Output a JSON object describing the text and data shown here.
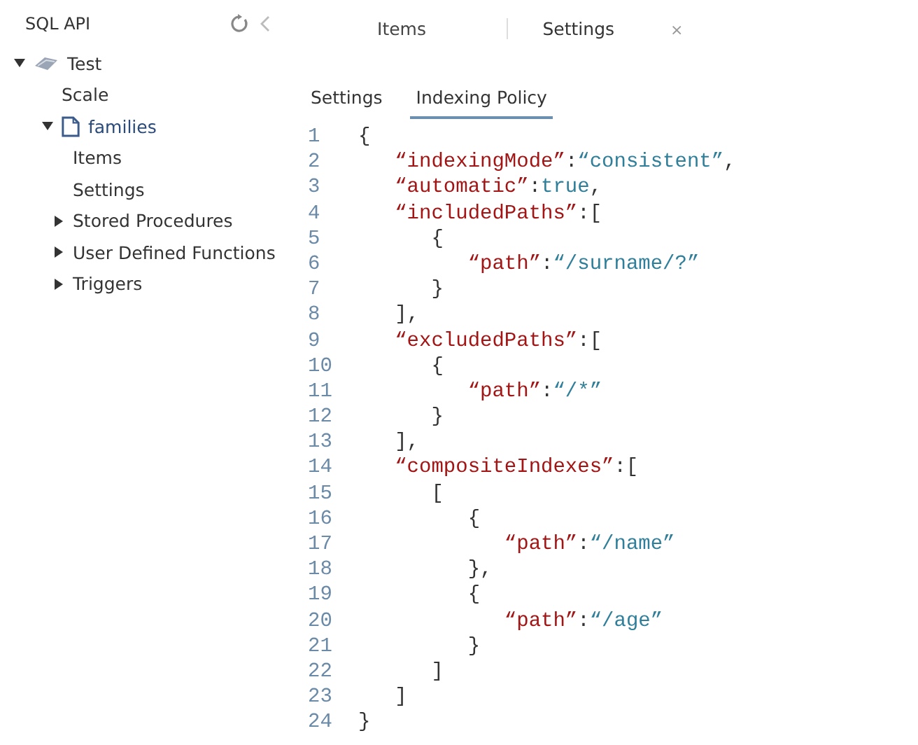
{
  "sidebar": {
    "title": "SQL API",
    "tree": [
      {
        "label": "Test",
        "kind": "database",
        "expanded": true,
        "children": [
          {
            "label": "Scale",
            "kind": "leaf"
          },
          {
            "label": "families",
            "kind": "collection",
            "expanded": true,
            "children": [
              {
                "label": "Items",
                "kind": "leaf"
              },
              {
                "label": "Settings",
                "kind": "leaf"
              },
              {
                "label": "Stored Procedures",
                "kind": "group",
                "expanded": false
              },
              {
                "label": "User Defined Functions",
                "kind": "group",
                "expanded": false
              },
              {
                "label": "Triggers",
                "kind": "group",
                "expanded": false
              }
            ]
          }
        ]
      }
    ]
  },
  "tabs": [
    {
      "label": "Items",
      "selected": false
    },
    {
      "label": "Settings",
      "selected": true,
      "close": "×"
    }
  ],
  "subtabs": [
    {
      "label": "Settings",
      "selected": false
    },
    {
      "label": "Indexing Policy",
      "selected": true
    }
  ],
  "editor": {
    "lines": [
      {
        "number": "1",
        "tokens": [
          {
            "kind": "punct",
            "text": "{"
          }
        ]
      },
      {
        "number": "2",
        "tokens": [
          {
            "kind": "key",
            "text": "   “indexingMode”"
          },
          {
            "kind": "punct",
            "text": ":"
          },
          {
            "kind": "string",
            "text": "“consistent”"
          },
          {
            "kind": "punct",
            "text": ","
          }
        ]
      },
      {
        "number": "3",
        "tokens": [
          {
            "kind": "key",
            "text": "   “automatic”"
          },
          {
            "kind": "punct",
            "text": ":"
          },
          {
            "kind": "string",
            "text": "true"
          },
          {
            "kind": "punct",
            "text": ","
          }
        ]
      },
      {
        "number": "4",
        "tokens": [
          {
            "kind": "key",
            "text": "   “includedPaths”"
          },
          {
            "kind": "punct",
            "text": ":["
          }
        ]
      },
      {
        "number": "5",
        "tokens": [
          {
            "kind": "punct",
            "text": "      {"
          }
        ]
      },
      {
        "number": "6",
        "tokens": [
          {
            "kind": "key",
            "text": "         “path”"
          },
          {
            "kind": "punct",
            "text": ":"
          },
          {
            "kind": "string",
            "text": "“/surname/?”"
          }
        ]
      },
      {
        "number": "7",
        "tokens": [
          {
            "kind": "punct",
            "text": "      }"
          }
        ]
      },
      {
        "number": "8",
        "tokens": [
          {
            "kind": "punct",
            "text": "   ],"
          }
        ]
      },
      {
        "number": "9",
        "tokens": [
          {
            "kind": "key",
            "text": "   “excludedPaths”"
          },
          {
            "kind": "punct",
            "text": ":["
          }
        ]
      },
      {
        "number": "10",
        "tokens": [
          {
            "kind": "punct",
            "text": "      {"
          }
        ]
      },
      {
        "number": "11",
        "tokens": [
          {
            "kind": "key",
            "text": "         “path”"
          },
          {
            "kind": "punct",
            "text": ":"
          },
          {
            "kind": "string",
            "text": "“/*”"
          }
        ]
      },
      {
        "number": "12",
        "tokens": [
          {
            "kind": "punct",
            "text": "      }"
          }
        ]
      },
      {
        "number": "13",
        "tokens": [
          {
            "kind": "punct",
            "text": "   ],"
          }
        ]
      },
      {
        "number": "14",
        "tokens": [
          {
            "kind": "key",
            "text": "   “compositeIndexes”"
          },
          {
            "kind": "punct",
            "text": ":["
          }
        ]
      },
      {
        "number": "15",
        "tokens": [
          {
            "kind": "punct",
            "text": "      ["
          }
        ]
      },
      {
        "number": "16",
        "tokens": [
          {
            "kind": "punct",
            "text": "         {"
          }
        ]
      },
      {
        "number": "17",
        "tokens": [
          {
            "kind": "key",
            "text": "            “path”"
          },
          {
            "kind": "punct",
            "text": ":"
          },
          {
            "kind": "string",
            "text": "“/name”"
          }
        ]
      },
      {
        "number": "18",
        "tokens": [
          {
            "kind": "punct",
            "text": "         },"
          }
        ]
      },
      {
        "number": "19",
        "tokens": [
          {
            "kind": "punct",
            "text": "         {"
          }
        ]
      },
      {
        "number": "20",
        "tokens": [
          {
            "kind": "key",
            "text": "            “path”"
          },
          {
            "kind": "punct",
            "text": ":"
          },
          {
            "kind": "string",
            "text": "“/age”"
          }
        ]
      },
      {
        "number": "21",
        "tokens": [
          {
            "kind": "punct",
            "text": "         }"
          }
        ]
      },
      {
        "number": "22",
        "tokens": [
          {
            "kind": "punct",
            "text": "      ]"
          }
        ]
      },
      {
        "number": "23",
        "tokens": [
          {
            "kind": "punct",
            "text": "   ]"
          }
        ]
      },
      {
        "number": "24",
        "tokens": [
          {
            "kind": "punct",
            "text": "}"
          }
        ]
      }
    ]
  }
}
